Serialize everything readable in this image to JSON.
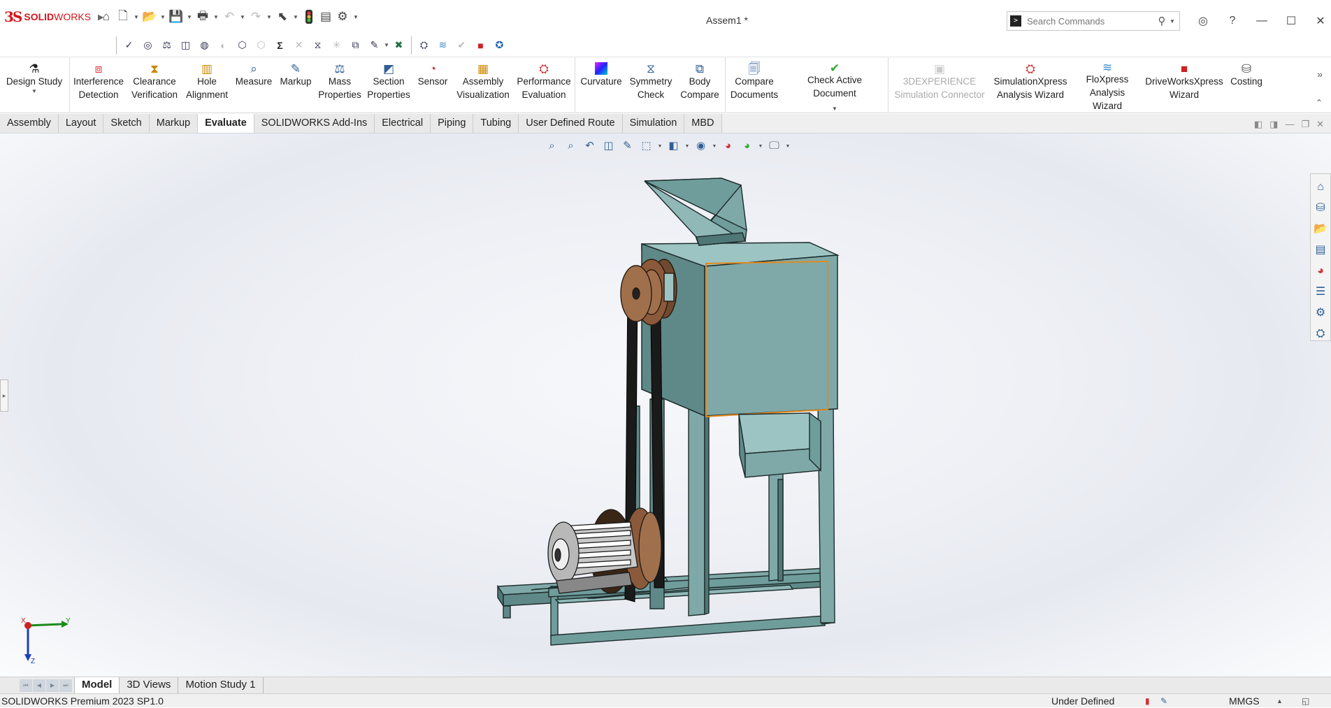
{
  "app": {
    "brand_ds": "3S",
    "brand_name_bold": "SOLID",
    "brand_name": "WORKS",
    "window_title": "Assem1 *"
  },
  "search": {
    "placeholder": "Search Commands"
  },
  "ribbon": {
    "items": [
      {
        "l1": "Design Study",
        "l2": ""
      },
      {
        "l1": "Interference",
        "l2": "Detection"
      },
      {
        "l1": "Clearance",
        "l2": "Verification"
      },
      {
        "l1": "Hole",
        "l2": "Alignment"
      },
      {
        "l1": "Measure",
        "l2": ""
      },
      {
        "l1": "Markup",
        "l2": ""
      },
      {
        "l1": "Mass",
        "l2": "Properties"
      },
      {
        "l1": "Section",
        "l2": "Properties"
      },
      {
        "l1": "Sensor",
        "l2": ""
      },
      {
        "l1": "Assembly",
        "l2": "Visualization"
      },
      {
        "l1": "Performance",
        "l2": "Evaluation"
      },
      {
        "l1": "Curvature",
        "l2": ""
      },
      {
        "l1": "Symmetry",
        "l2": "Check"
      },
      {
        "l1": "Body",
        "l2": "Compare"
      },
      {
        "l1": "Compare",
        "l2": "Documents"
      },
      {
        "l1": "Check Active Document",
        "l2": ""
      },
      {
        "l1": "3DEXPERIENCE",
        "l2": "Simulation Connector"
      },
      {
        "l1": "SimulationXpress",
        "l2": "Analysis Wizard"
      },
      {
        "l1": "FloXpress",
        "l2": "Analysis Wizard"
      },
      {
        "l1": "DriveWorksXpress",
        "l2": "Wizard"
      },
      {
        "l1": "Costing",
        "l2": ""
      }
    ]
  },
  "tabs": [
    "Assembly",
    "Layout",
    "Sketch",
    "Markup",
    "Evaluate",
    "SOLIDWORKS Add-Ins",
    "Electrical",
    "Piping",
    "Tubing",
    "User Defined Route",
    "Simulation",
    "MBD"
  ],
  "active_tab": "Evaluate",
  "triad": {
    "x": "X",
    "y": "Y",
    "z": "Z"
  },
  "bottom_tabs": [
    "Model",
    "3D Views",
    "Motion Study 1"
  ],
  "status": {
    "product": "SOLIDWORKS Premium 2023 SP1.0",
    "state": "Under Defined",
    "units": "MMGS"
  },
  "colors": {
    "brand": "#d3161c",
    "machine": "#6f9d9c",
    "pulley": "#8b5a3a",
    "selection": "#e08a1e"
  }
}
